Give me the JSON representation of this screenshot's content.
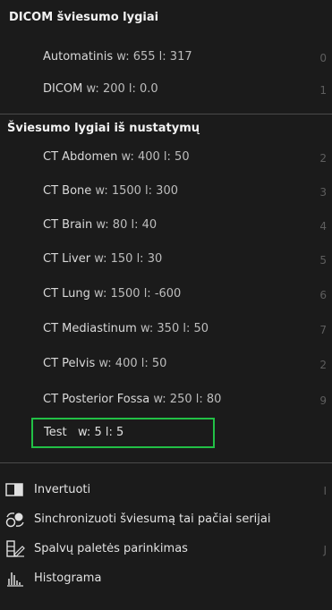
{
  "dicom_section": {
    "title": "DICOM šviesumo lygiai",
    "items": [
      {
        "name": "Automatinis",
        "wl": "w: 655  l: 317",
        "hotkey": "0"
      },
      {
        "name": "DICOM",
        "wl": "w: 200  l: 0.0",
        "hotkey": "1"
      }
    ]
  },
  "preset_section": {
    "title": "Šviesumo lygiai iš nustatymų",
    "items": [
      {
        "name": "CT Abdomen",
        "wl": "w: 400 l: 50",
        "hotkey": "2"
      },
      {
        "name": "CT Bone",
        "wl": "w: 1500 l: 300",
        "hotkey": "3"
      },
      {
        "name": "CT Brain",
        "wl": "w: 80 l: 40",
        "hotkey": "4"
      },
      {
        "name": "CT Liver",
        "wl": "w: 150 l: 30",
        "hotkey": "5"
      },
      {
        "name": "CT Lung",
        "wl": "w: 1500 l: -600",
        "hotkey": "6"
      },
      {
        "name": "CT Mediastinum",
        "wl": "w: 350 l: 50",
        "hotkey": "7"
      },
      {
        "name": "CT Pelvis",
        "wl": "w: 400 l: 50",
        "hotkey": "2"
      },
      {
        "name": "CT Posterior Fossa",
        "wl": "w: 250 l: 80",
        "hotkey": "9"
      }
    ],
    "test": {
      "name": "Test",
      "wl": "w: 5  l: 5"
    }
  },
  "actions": [
    {
      "label": "Invertuoti",
      "hotkey": "I",
      "icon": "invert-icon"
    },
    {
      "label": "Sinchronizuoti šviesumą tai pačiai serijai",
      "hotkey": "",
      "icon": "sync-icon"
    },
    {
      "label": "Spalvų paletės parinkimas",
      "hotkey": "J",
      "icon": "palette-icon"
    },
    {
      "label": "Histograma",
      "hotkey": "",
      "icon": "histogram-icon"
    }
  ],
  "colors": {
    "background": "#1b1b1b",
    "highlight": "#22c046"
  }
}
